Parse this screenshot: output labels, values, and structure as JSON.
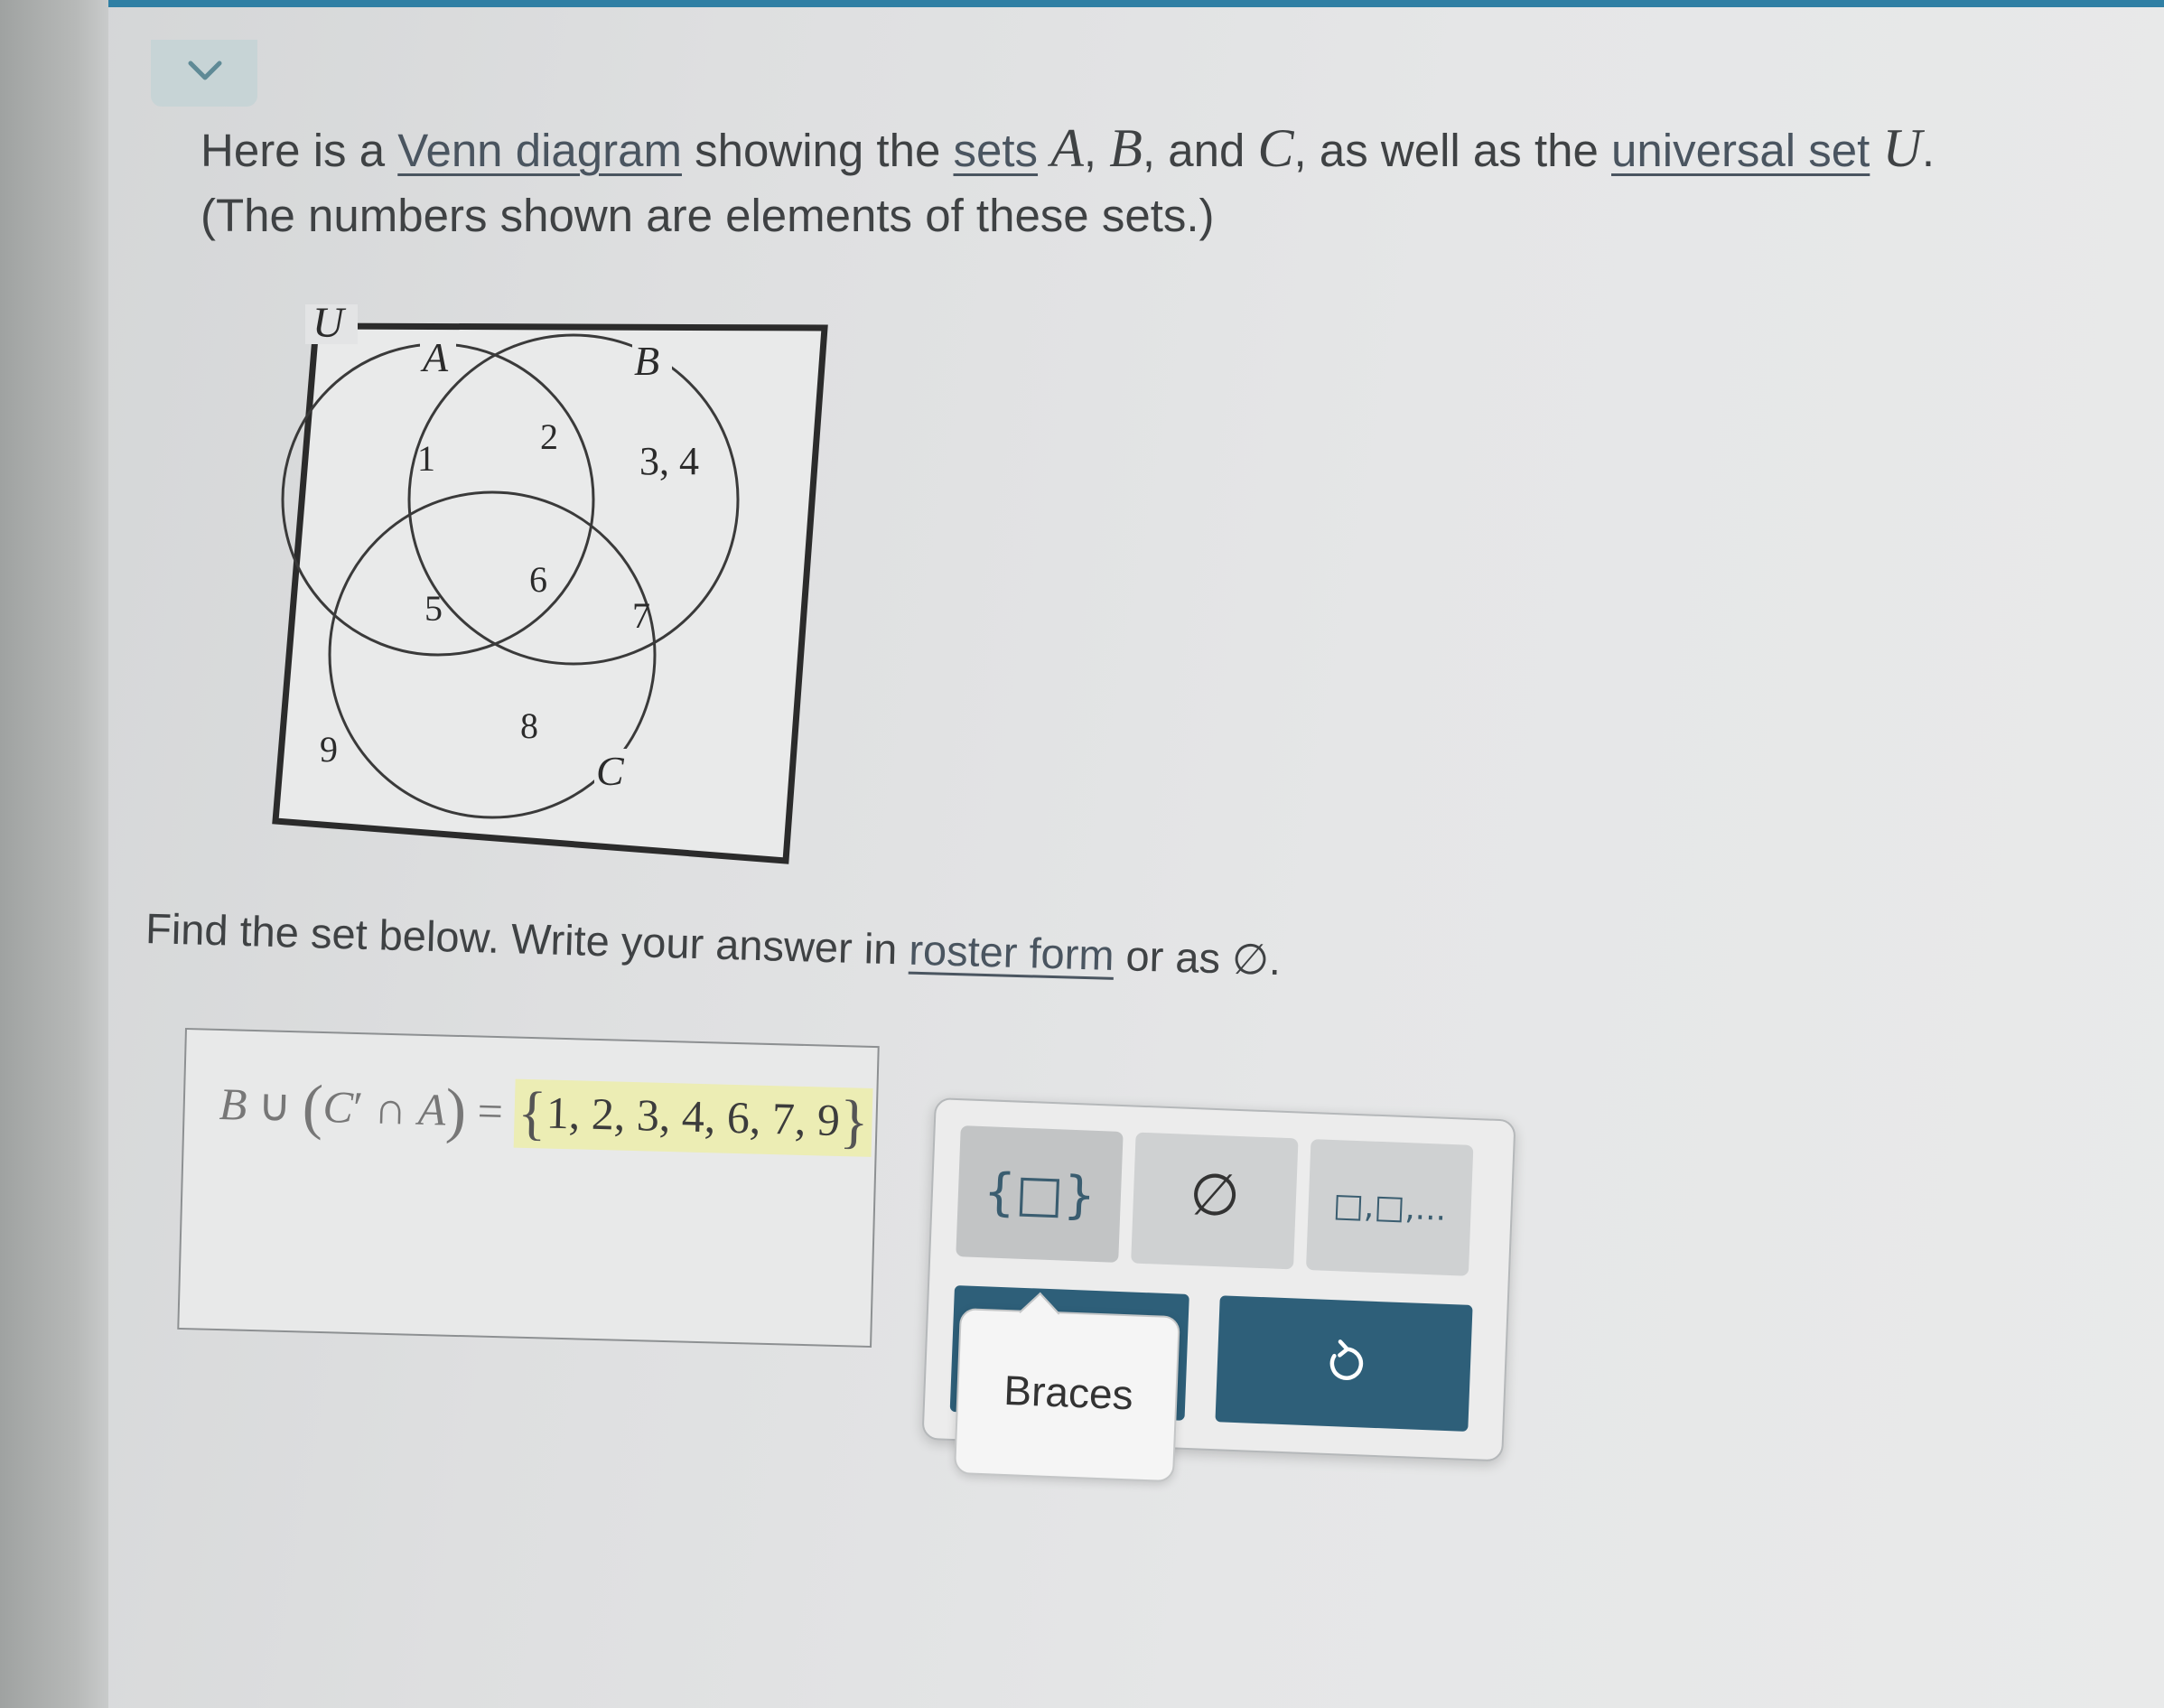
{
  "header": {
    "collapse_icon": "chevron-down-icon"
  },
  "intro": {
    "t1": "Here is a ",
    "link_venn": "Venn diagram",
    "t2": " showing the ",
    "link_sets": "sets",
    "t3": " ",
    "var_a": "A",
    "t4": ", ",
    "var_b": "B",
    "t5": ", and ",
    "var_c": "C",
    "t6": ", as well as the ",
    "link_universal": "universal set",
    "t7": " ",
    "var_u": "U",
    "t8": ".",
    "line2": "(The numbers shown are elements of these sets.)"
  },
  "venn": {
    "label_u": "U",
    "label_a": "A",
    "label_b": "B",
    "label_c": "C",
    "only_a": "1",
    "a_and_b": "2",
    "only_b": "3, 4",
    "a_and_c": "5",
    "a_b_c": "6",
    "b_and_c": "7",
    "only_c": "8",
    "outside": "9"
  },
  "question": {
    "t1": "Find the set below. Write your answer in ",
    "link_roster": "roster form",
    "t2": " or as ",
    "empty_symbol": "∅",
    "t3": "."
  },
  "answer": {
    "expr_b": "B",
    "union": " ∪ ",
    "open_paren": "(",
    "expr_c": "C",
    "prime": "′",
    "intersect": " ∩ ",
    "expr_a": "A",
    "close_paren": ")",
    "equals": " = ",
    "open_brace": "{",
    "value": "1, 2, 3, 4, 6, 7, 9",
    "close_brace": "}"
  },
  "toolbar": {
    "braces_glyph": "{□}",
    "empty_set_glyph": "∅",
    "list_glyph": "□,□,...",
    "tooltip": "Braces",
    "undo_icon": "undo-icon"
  }
}
